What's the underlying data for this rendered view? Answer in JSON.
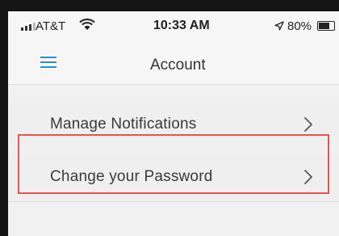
{
  "status_bar": {
    "carrier": "AT&T",
    "time": "10:33 AM",
    "battery_percent": "80%",
    "battery_level": 0.8,
    "icons": [
      "signal-bars-icon",
      "wifi-icon",
      "location-arrow-icon",
      "battery-icon"
    ]
  },
  "nav_bar": {
    "title": "Account",
    "menu_icon": "hamburger-menu-icon",
    "accent_color": "#2c8ec8"
  },
  "settings": {
    "items": [
      {
        "label": "Manage Notifications",
        "icon": "chevron-right-icon"
      },
      {
        "label": "Change your Password",
        "icon": "chevron-right-icon",
        "highlighted": true
      }
    ]
  },
  "annotation": {
    "highlight_color": "#e8534f"
  }
}
